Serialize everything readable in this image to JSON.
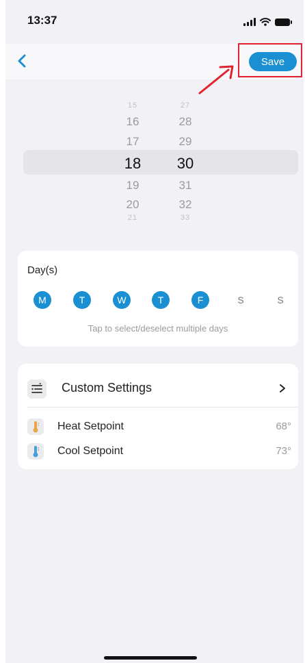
{
  "status_bar": {
    "time": "13:37"
  },
  "nav": {
    "save_label": "Save"
  },
  "picker": {
    "hours": {
      "far_above": "15",
      "above_2": "16",
      "above_1": "17",
      "selected": "18",
      "below_1": "19",
      "below_2": "20",
      "far_below": "21"
    },
    "minutes": {
      "far_above": "27",
      "above_2": "28",
      "above_1": "29",
      "selected": "30",
      "below_1": "31",
      "below_2": "32",
      "far_below": "33"
    }
  },
  "days": {
    "title": "Day(s)",
    "items": [
      {
        "label": "M",
        "selected": true
      },
      {
        "label": "T",
        "selected": true
      },
      {
        "label": "W",
        "selected": true
      },
      {
        "label": "T",
        "selected": true
      },
      {
        "label": "F",
        "selected": true
      },
      {
        "label": "S",
        "selected": false
      },
      {
        "label": "S",
        "selected": false
      }
    ],
    "hint": "Tap to select/deselect multiple days"
  },
  "settings": {
    "custom_label": "Custom Settings",
    "heat": {
      "label": "Heat Setpoint",
      "value": "68°"
    },
    "cool": {
      "label": "Cool Setpoint",
      "value": "73°"
    }
  },
  "colors": {
    "accent": "#1a8fd1",
    "highlight": "#e0232e",
    "heat_icon": "#e8a54a",
    "cool_icon": "#4a9fd8"
  }
}
